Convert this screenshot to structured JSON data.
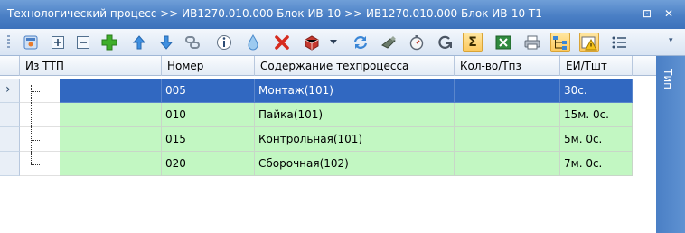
{
  "window": {
    "title": "Технологический процесс >> ИВ1270.010.000 Блок ИВ-10 >> ИВ1270.010.000 Блок ИВ-10 Т1",
    "pin_glyph": "⊡",
    "close_glyph": "✕"
  },
  "toolbar": {
    "buttons": [
      {
        "name": "properties-icon"
      },
      {
        "name": "expand-plus-icon"
      },
      {
        "name": "collapse-minus-icon"
      },
      {
        "name": "add-green-plus-icon"
      },
      {
        "name": "move-up-arrow-icon"
      },
      {
        "name": "move-down-arrow-icon"
      },
      {
        "name": "link-chain-icon"
      },
      {
        "name": "info-icon"
      },
      {
        "name": "drop-icon"
      },
      {
        "name": "delete-x-icon"
      },
      {
        "name": "package-icon"
      },
      {
        "name": "dropdown-arrow-icon"
      },
      {
        "name": "refresh-icon"
      },
      {
        "name": "tool-icon"
      },
      {
        "name": "stopwatch-icon"
      },
      {
        "name": "recalc-icon"
      },
      {
        "name": "sum-sigma-icon"
      },
      {
        "name": "excel-icon"
      },
      {
        "name": "print-icon"
      },
      {
        "name": "tree-view-icon"
      },
      {
        "name": "warning-folder-icon"
      },
      {
        "name": "list-icon"
      }
    ],
    "sigma_glyph": "Σ",
    "overflow_glyph": "▾"
  },
  "grid": {
    "columns": [
      "Из ТТП",
      "Номер",
      "Содержание техпроцесса",
      "Кол-во/Тпз",
      "ЕИ/Тшт"
    ],
    "rows": [
      {
        "number": "005",
        "content": "Монтаж(101)",
        "qty": "",
        "unit": "30с.",
        "selected": true
      },
      {
        "number": "010",
        "content": "Пайка(101)",
        "qty": "",
        "unit": "15м. 0с.",
        "selected": false
      },
      {
        "number": "015",
        "content": "Контрольная(101)",
        "qty": "",
        "unit": "5м. 0с.",
        "selected": false
      },
      {
        "number": "020",
        "content": "Сборочная(102)",
        "qty": "",
        "unit": "7м. 0с.",
        "selected": false
      }
    ],
    "current_row_marker": "›"
  },
  "side_panel": {
    "label": "Тип"
  },
  "colors": {
    "selection": "#3168c1",
    "row_green": "#c2f7c2",
    "titlebar": "#4a7fc5"
  }
}
